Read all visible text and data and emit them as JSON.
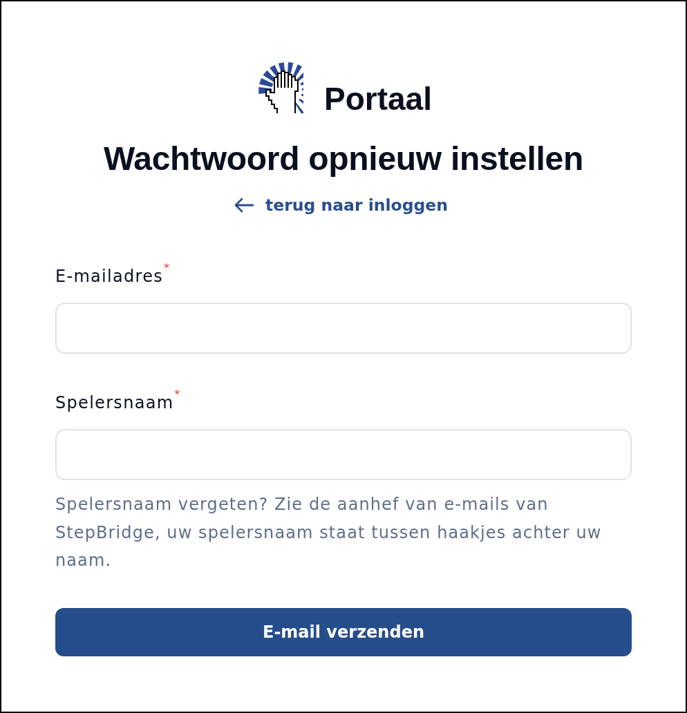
{
  "brand": {
    "name": "Portaal"
  },
  "title": "Wachtwoord opnieuw instellen",
  "back_link": {
    "label": "terug naar inloggen"
  },
  "fields": [
    {
      "label": "E-mailadres",
      "required_mark": "*"
    },
    {
      "label": "Spelersnaam",
      "required_mark": "*",
      "hint": "Spelersnaam vergeten? Zie de aanhef van e-mails van StepBridge, uw spelersnaam staat tussen haakjes achter uw naam."
    }
  ],
  "submit_button": {
    "label": "E-mail verzenden"
  }
}
